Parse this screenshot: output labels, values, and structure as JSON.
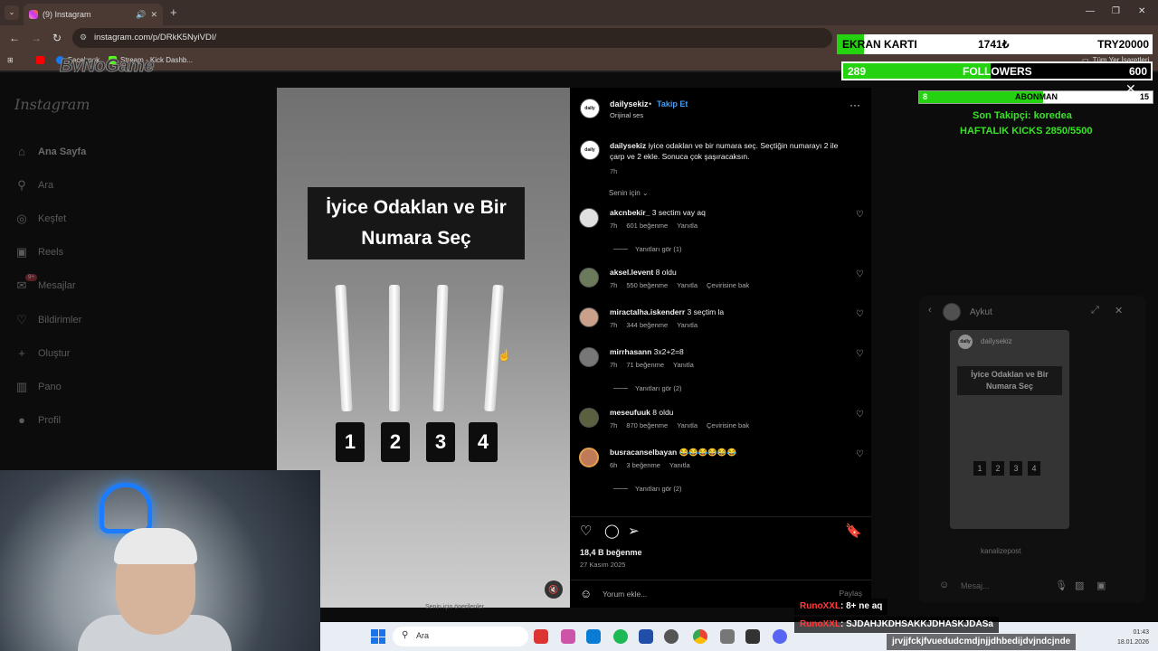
{
  "browser": {
    "tab_title": "(9) Instagram",
    "url": "instagram.com/p/DRkK5NyiVDI/",
    "bookmarks": [
      "Facebook",
      "Stream - Kick Dashb..."
    ],
    "all_bookmarks": "Tüm Yer İşaretleri"
  },
  "brand": "ByNoGame",
  "instagram": {
    "logo": "Instagram",
    "nav": [
      {
        "label": "Ana Sayfa",
        "icon": "home-icon"
      },
      {
        "label": "Ara",
        "icon": "search-icon"
      },
      {
        "label": "Keşfet",
        "icon": "compass-icon"
      },
      {
        "label": "Reels",
        "icon": "reels-icon"
      },
      {
        "label": "Mesajlar",
        "icon": "messenger-icon",
        "badge": "9+"
      },
      {
        "label": "Bildirimler",
        "icon": "heart-icon"
      },
      {
        "label": "Oluştur",
        "icon": "plus-icon"
      },
      {
        "label": "Pano",
        "icon": "dashboard-icon"
      },
      {
        "label": "Profil",
        "icon": "profile-icon"
      }
    ],
    "post": {
      "title_line1": "İyice Odaklan ve Bir",
      "title_line2": "Numara Seç",
      "numbers": [
        "1",
        "2",
        "3",
        "4"
      ],
      "recommended": "Senin için önerilenler"
    },
    "panel": {
      "username": "dailysekiz",
      "follow": "Takip Et",
      "audio": "Orijinal ses",
      "caption_user": "dailysekiz",
      "caption_text": "iyice odaklan ve bir numara seç. Seçtiğin numarayı 2 ile çarp ve 2 ekle. Sonuca çok şaşıracaksın.",
      "caption_time": "7h",
      "for_you": "Senin için",
      "comments": [
        {
          "user": "akcnbekir_",
          "text": "3 sectim vay aq",
          "time": "7h",
          "likes": "601 beğenme",
          "reply": "Yanıtla",
          "translate": "",
          "replies": "Yanıtları gör (1)"
        },
        {
          "user": "aksel.levent",
          "text": "8 oldu",
          "time": "7h",
          "likes": "550 beğenme",
          "reply": "Yanıtla",
          "translate": "Çevirisine bak",
          "replies": ""
        },
        {
          "user": "miractalha.iskenderr",
          "text": "3 seçtim la",
          "time": "7h",
          "likes": "344 beğenme",
          "reply": "Yanıtla",
          "translate": "",
          "replies": ""
        },
        {
          "user": "mirrhasann",
          "text": "3x2+2=8",
          "time": "7h",
          "likes": "71 beğenme",
          "reply": "Yanıtla",
          "translate": "",
          "replies": "Yanıtları gör (2)"
        },
        {
          "user": "meseufuuk",
          "text": "8 oldu",
          "time": "7h",
          "likes": "870 beğenme",
          "reply": "Yanıtla",
          "translate": "Çevirisine bak",
          "replies": ""
        },
        {
          "user": "busracanselbayan",
          "text": "😂😂😂😂😂😂",
          "time": "6h",
          "likes": "3 beğenme",
          "reply": "Yanıtla",
          "translate": "",
          "replies": "Yanıtları gör (2)"
        }
      ],
      "likes_total": "18,4 B beğenme",
      "date": "27 Kasım 2025",
      "comment_placeholder": "Yorum ekle...",
      "share": "Paylaş"
    }
  },
  "overlay": {
    "gpu_label": "EKRAN KARTI",
    "gpu_current": "1741₺",
    "gpu_target": "TRY20000",
    "gpu_progress": 0.087,
    "followers_current": "289",
    "followers_label": "FOLLOWERS",
    "followers_target": "600",
    "followers_progress": 0.48,
    "sub_current": "8",
    "sub_label": "ABONMAN",
    "sub_target": "15",
    "sub_progress": 0.53,
    "last_follower": "Son Takipçi: koredea",
    "weekly_kicks": "HAFTALIK KICKS 2850/5500"
  },
  "dm": {
    "name": "Aykut",
    "card_user": "dailysekiz",
    "card_title": "İyice Odaklan ve Bir Numara Seç",
    "numbers": [
      "1",
      "2",
      "3",
      "4"
    ],
    "user2": "kanalizepost",
    "input_placeholder": "Mesaj..."
  },
  "taskbar": {
    "search": "Ara",
    "time": "01:43",
    "date": "18.01.2026"
  },
  "chat": [
    {
      "user": "RunoXXL",
      "text": ": 8+ ne aq"
    },
    {
      "user": "RunoXXL",
      "text": ": SJDAHJKDHSAKKJDHASKJDASa"
    },
    {
      "user": "",
      "text": "jrvjjfckjfvuedudcmdjnjjdhbedijdvjndcjnde"
    }
  ],
  "colors": {
    "accent_green": "#25d20f",
    "link_blue": "#4a9df0",
    "chat_user": "#ff3b3b"
  }
}
